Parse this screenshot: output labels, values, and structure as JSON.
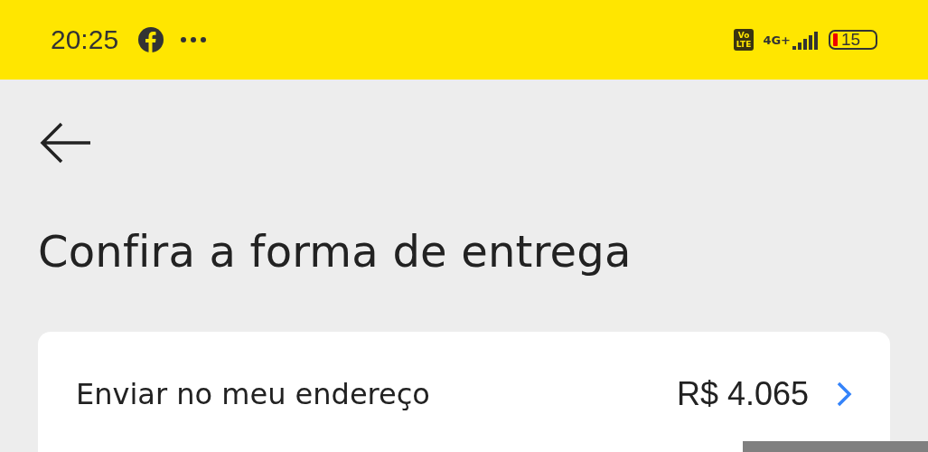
{
  "status_bar": {
    "time": "20:25",
    "battery": "15",
    "network": "4G+",
    "volte": [
      "Vo",
      "LTE"
    ]
  },
  "title": "Confira a forma de entrega",
  "delivery_option": {
    "label": "Enviar no meu endereço",
    "price": "R$ 4.065"
  }
}
